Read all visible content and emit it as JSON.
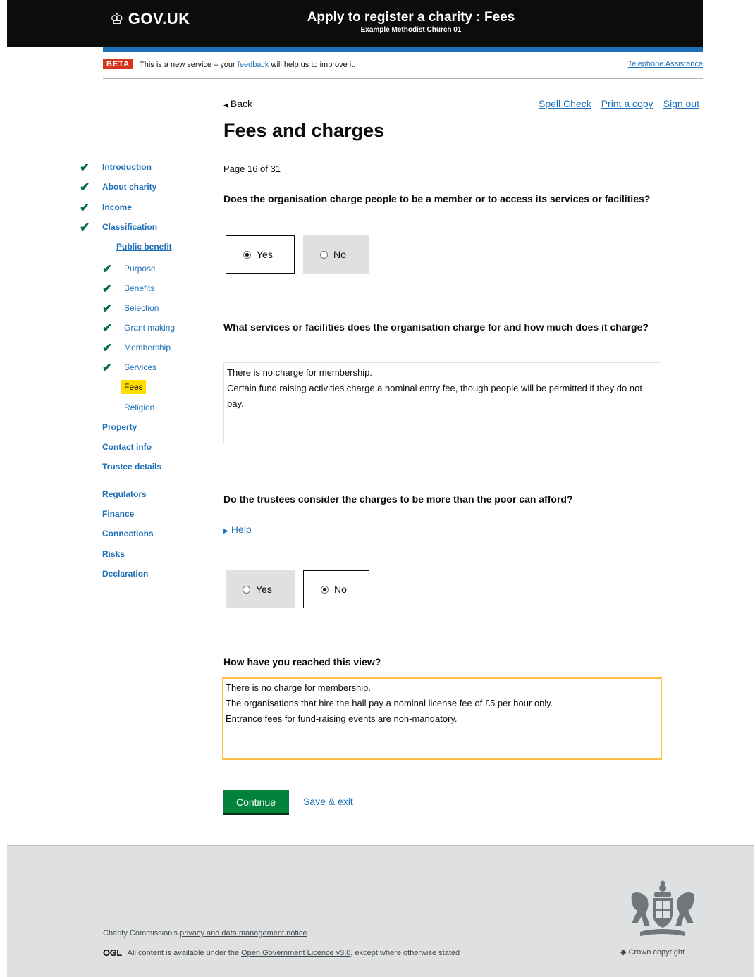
{
  "header": {
    "logo_glyph": "♔",
    "logo_text": "GOV.UK",
    "service_title": "Apply to register a charity : Fees",
    "service_subtitle": "Example Methodist Church 01"
  },
  "phase_banner": {
    "tag": "BETA",
    "text_before": "This is a new service – your ",
    "feedback_link": "feedback",
    "text_after": " will help us to improve it.",
    "telephone_link": "Telephone Assistance"
  },
  "top_links": {
    "back": "Back",
    "spell_check": "Spell Check",
    "print": "Print a copy",
    "sign_out": "Sign out"
  },
  "page_title": "Fees and charges",
  "sidebar": {
    "tick_glyph": "✔",
    "items": {
      "introduction": "Introduction",
      "about_charity": "About charity",
      "income": "Income",
      "classification": "Classification",
      "public_benefit": "Public benefit",
      "purpose": "Purpose",
      "benefits": "Benefits",
      "selection": "Selection",
      "grant_making": "Grant making",
      "membership": "Membership",
      "services": "Services",
      "fees": "Fees",
      "religion": "Religion",
      "property": "Property",
      "contact_info": "Contact info",
      "trustee_details": "Trustee details",
      "regulators": "Regulators",
      "finance": "Finance",
      "connections": "Connections",
      "risks": "Risks",
      "declaration": "Declaration"
    }
  },
  "main": {
    "page_count": "Page 16 of 31",
    "q1": {
      "text": "Does the organisation charge people to be a member or to access its services or facilities?",
      "yes": "Yes",
      "no": "No",
      "selected": "Yes"
    },
    "q2": {
      "text": "What services or facilities does the organisation charge for and how much does it charge?",
      "answer": "There is no charge for membership.\nCertain fund raising activities charge a nominal entry fee, though people will be permitted if they do not pay."
    },
    "q3": {
      "text": "Do the trustees consider the charges to be more than the poor can afford?",
      "help": "Help",
      "yes": "Yes",
      "no": "No",
      "selected": "No"
    },
    "q4": {
      "text": "How have you reached this view?",
      "answer": "There is no charge for membership.\nThe organisations that hire the hall pay a nominal license fee of £5 per hour only.\nEntrance fees for fund-raising events are non-mandatory."
    },
    "continue": "Continue",
    "save_exit": "Save & exit"
  },
  "footer": {
    "privacy_prefix": "Charity Commission's ",
    "privacy_link": "privacy and data management notice",
    "ogl_logo": "OGL",
    "licence_prefix": "All content is available under the ",
    "licence_link": "Open Government Licence v3.0",
    "licence_suffix": ", except where otherwise stated",
    "copyright": "Crown copyright"
  },
  "colors": {
    "header_bg": "#0b0c0c",
    "brand_blue": "#1d70b8",
    "beta_red": "#d4351c",
    "tick_green": "#00703c",
    "button_green": "#00823b",
    "focus_yellow": "#ffbf47",
    "current_highlight": "#ffdd00",
    "footer_bg": "#dee0e2"
  }
}
